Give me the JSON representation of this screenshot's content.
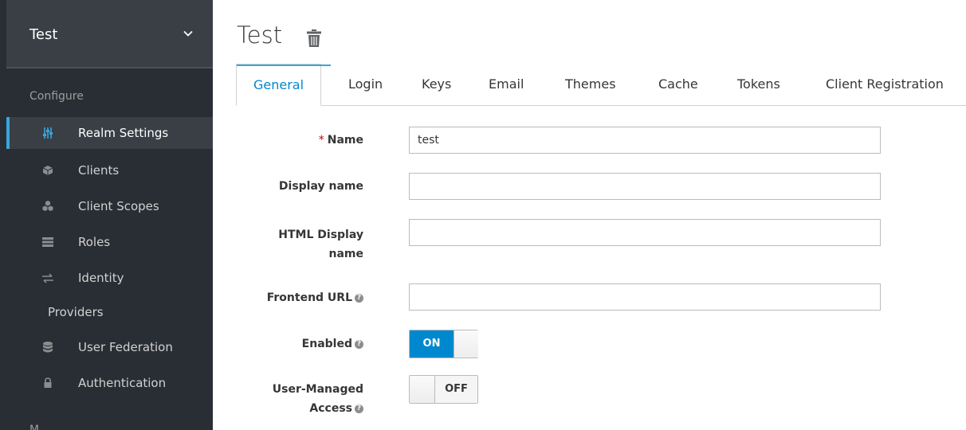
{
  "sidebar": {
    "realm": "Test",
    "section_configure": "Configure",
    "items": [
      {
        "label": "Realm Settings",
        "icon": "sliders-icon",
        "active": true
      },
      {
        "label": "Clients",
        "icon": "cube-icon"
      },
      {
        "label": "Client Scopes",
        "icon": "cubes-icon"
      },
      {
        "label": "Roles",
        "icon": "roles-icon"
      },
      {
        "label": "Identity",
        "label_wrap": "Providers",
        "icon": "exchange-icon"
      },
      {
        "label": "User Federation",
        "icon": "database-icon"
      },
      {
        "label": "Authentication",
        "icon": "lock-icon"
      }
    ],
    "section_manage_partial": "M..."
  },
  "page": {
    "title": "Test"
  },
  "tabs": [
    {
      "label": "General",
      "active": true
    },
    {
      "label": "Login"
    },
    {
      "label": "Keys"
    },
    {
      "label": "Email"
    },
    {
      "label": "Themes"
    },
    {
      "label": "Cache"
    },
    {
      "label": "Tokens"
    },
    {
      "label": "Client Registration"
    }
  ],
  "form": {
    "name_label": "Name",
    "name_required_mark": "*",
    "name_value": "test",
    "display_name_label": "Display name",
    "display_name_value": "",
    "html_display_name_label_1": "HTML Display",
    "html_display_name_label_2": "name",
    "html_display_name_value": "",
    "frontend_url_label": "Frontend URL",
    "frontend_url_value": "",
    "enabled_label": "Enabled",
    "enabled_state": "ON",
    "uma_label_1": "User-Managed",
    "uma_label_2": "Access",
    "uma_state": "OFF"
  },
  "colors": {
    "accent": "#0088ce",
    "sidebar_bg": "#292e34",
    "sidebar_active": "#393f44",
    "active_bar": "#39a5dc",
    "required": "#cc0000"
  }
}
